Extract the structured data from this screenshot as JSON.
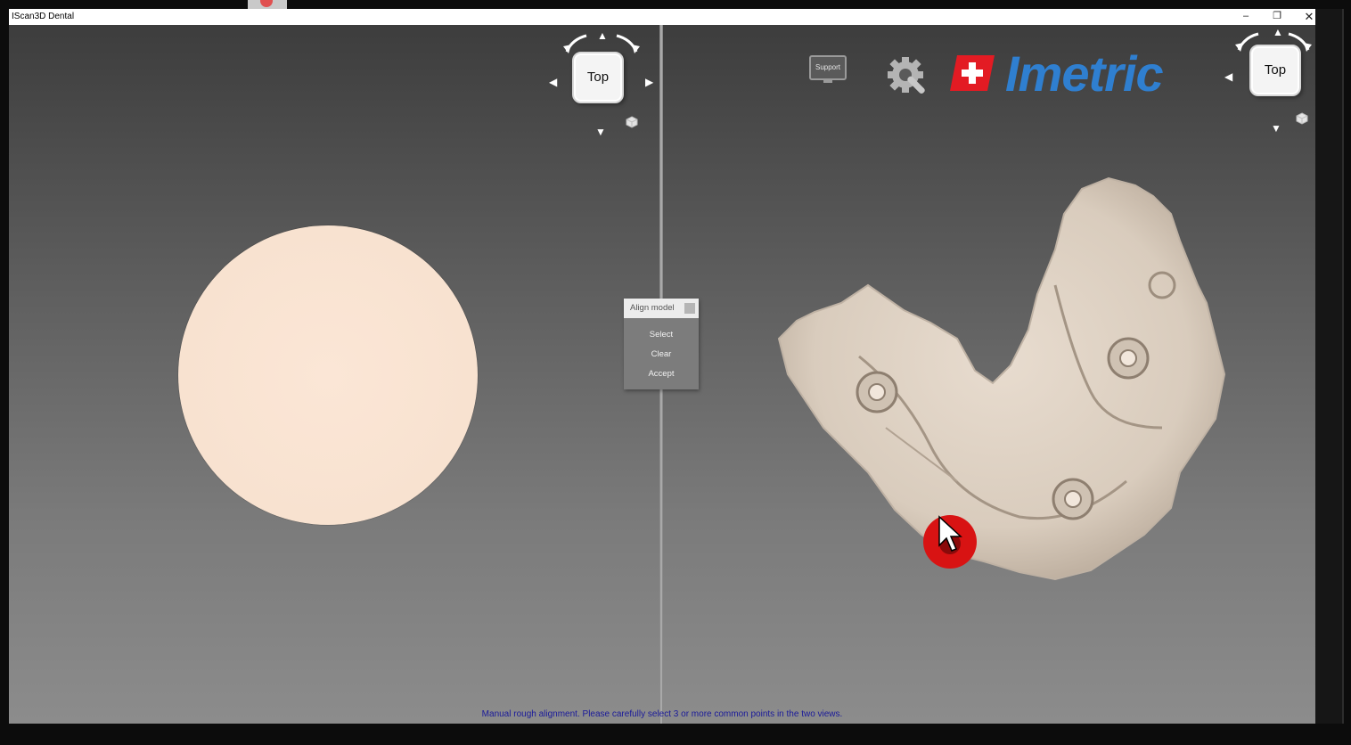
{
  "window": {
    "title": "IScan3D Dental",
    "controls": {
      "minimize": "–",
      "restore": "❐",
      "close": "✕"
    }
  },
  "left_view": {
    "navcube_label": "Top"
  },
  "right_view": {
    "navcube_label": "Top",
    "support_label": "Support",
    "brand_name": "Imetric"
  },
  "align_panel": {
    "title": "Align model",
    "items": [
      "Select",
      "Clear",
      "Accept"
    ]
  },
  "status_text": "Manual rough alignment. Please carefully select 3 or more common points in the two views.",
  "colors": {
    "brand_blue": "#2f7fd0",
    "swiss_red": "#e31b23",
    "status_text": "#1a1a9a",
    "selection_marker": "#d81313"
  }
}
